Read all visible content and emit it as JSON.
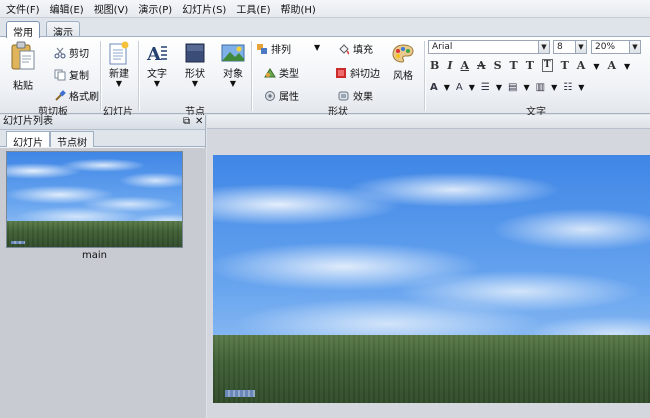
{
  "menu": [
    "文件(F)",
    "编辑(E)",
    "视图(V)",
    "演示(P)",
    "幻灯片(S)",
    "工具(E)",
    "帮助(H)"
  ],
  "tabs": [
    {
      "label": "常用",
      "active": true
    },
    {
      "label": "演示",
      "active": false
    }
  ],
  "ribbon": {
    "clipboard": {
      "paste": "粘贴",
      "cut": "剪切",
      "copy": "复制",
      "format_painter": "格式刷",
      "group": "剪切板"
    },
    "slide": {
      "new": "新建",
      "group": "幻灯片"
    },
    "node": {
      "text": "文字",
      "shape": "形状",
      "object": "对象",
      "group": "节点"
    },
    "shape": {
      "arrange": "排列",
      "type": "类型",
      "property": "属性",
      "fill": "填充",
      "bevel": "斜切边",
      "effect": "效果",
      "style": "风格",
      "group": "形状"
    },
    "text": {
      "font": "Arial",
      "size": "8",
      "zoom": "20%",
      "group": "文字"
    }
  },
  "left_panel": {
    "title": "幻灯片列表",
    "tabs": [
      "幻灯片",
      "节点树"
    ],
    "slides": [
      {
        "label": "main"
      }
    ]
  },
  "colors": {
    "sky_top": "#3f86e6",
    "grass": "#3f5f35",
    "ribbon_bg": "#eef1f5"
  },
  "icons": [
    "paste-icon",
    "scissors-icon",
    "copy-icon",
    "brush-icon",
    "new-slide-icon",
    "text-icon",
    "shape-icon",
    "object-icon",
    "arrange-icon",
    "type-icon",
    "property-icon",
    "fill-icon",
    "bevel-icon",
    "effect-icon",
    "palette-icon"
  ]
}
